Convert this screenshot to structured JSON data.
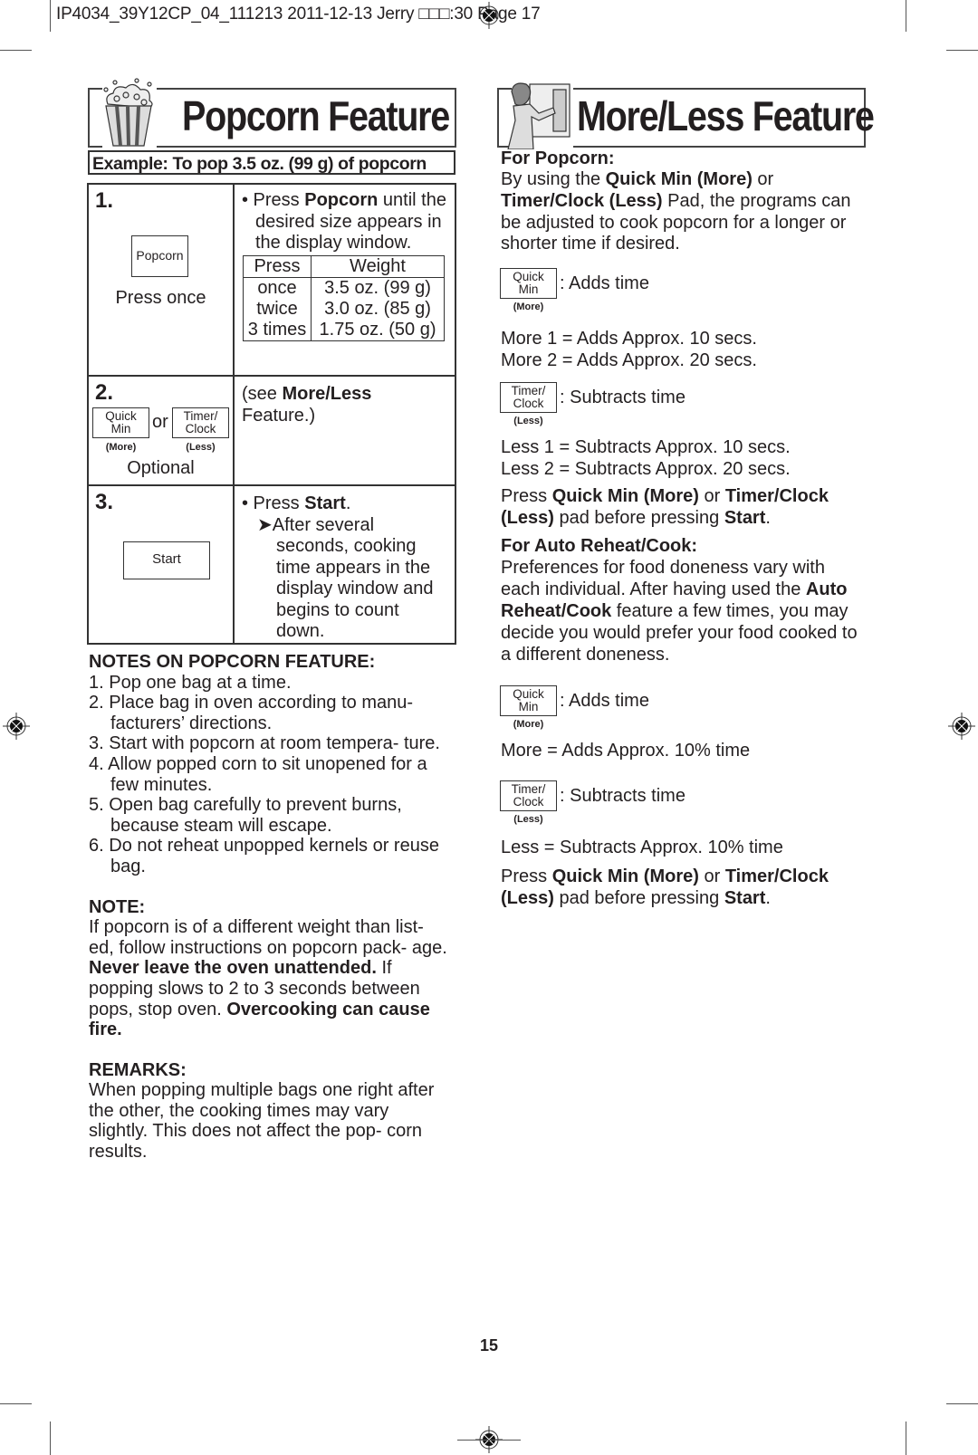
{
  "slug": "IP4034_39Y12CP_04_111213  2011-12-13  Jerry □□□:30  Page 17",
  "popcorn": {
    "title": "Popcorn Feature",
    "example": "Example: To pop 3.5 oz. (99 g) of popcorn",
    "steps": [
      {
        "number": "1.",
        "pad_label": "Popcorn",
        "caption": "Press once",
        "text_pre": "• Press ",
        "text_bold": "Popcorn",
        "text_post": " until the desired size appears in the display window.",
        "weights": {
          "headers": [
            "Press",
            "Weight"
          ],
          "rows": [
            [
              "once",
              "3.5 oz. (99 g)"
            ],
            [
              "twice",
              "3.0 oz. (85 g)"
            ],
            [
              "3 times",
              "1.75 oz. (50 g)"
            ]
          ]
        }
      },
      {
        "number": "2.",
        "pad_more_line1": "Quick",
        "pad_more_line2": "Min",
        "pad_more_sub": "(More)",
        "or": "or",
        "pad_less_line1": "Timer/",
        "pad_less_line2": "Clock",
        "pad_less_sub": "(Less)",
        "caption": "Optional",
        "text_pre": "(see ",
        "text_bold": "More/Less",
        "text_post": " Feature.)"
      },
      {
        "number": "3.",
        "pad_label": "Start",
        "text_pre": "• Press ",
        "text_bold": "Start",
        "text_post": ".",
        "arrow": "➤",
        "subtext": "After several seconds, cooking time appears in the display window and begins to count down."
      }
    ],
    "notes_title": "NOTES ON POPCORN FEATURE:",
    "notes": [
      {
        "n": "1.",
        "text": "Pop one bag at a time."
      },
      {
        "n": "2.",
        "text": "Place bag in oven according to manu- facturers’ directions."
      },
      {
        "n": "3.",
        "text": "Start with popcorn at room tempera- ture."
      },
      {
        "n": "4.",
        "text": "Allow popped corn to sit unopened for a few minutes."
      },
      {
        "n": "5.",
        "text": "Open bag carefully to prevent burns, because steam will escape."
      },
      {
        "n": "6.",
        "text": "Do not reheat unpopped kernels or reuse bag."
      }
    ],
    "note_title": "NOTE:",
    "note_p1": "If popcorn is of a different weight than list- ed, follow instructions on popcorn pack- age. ",
    "note_b1": "Never leave the oven unattended.",
    "note_p2": " If popping slows to 2 to 3 seconds between pops, stop oven. ",
    "note_b2": "Overcooking can cause fire.",
    "remarks_title": "REMARKS:",
    "remarks": "When popping multiple bags one right after the other, the cooking times may vary slightly. This does not affect the pop- corn results."
  },
  "moreless": {
    "title": "More/Less Feature",
    "popcorn_heading": "For Popcorn:",
    "popcorn_intro": {
      "t1": "By using the ",
      "b1": "Quick Min (More)",
      "t2": " or ",
      "b2": "Timer/Clock (Less)",
      "t3": " Pad, the programs can be adjusted to cook popcorn for a longer or shorter time if desired."
    },
    "pad_more": {
      "line1": "Quick",
      "line2": "Min",
      "sub": "(More)",
      "label": ": Adds time"
    },
    "pad_less": {
      "line1": "Timer/",
      "line2": "Clock",
      "sub": "(Less)",
      "label": ": Subtracts time"
    },
    "more_lines": [
      "More 1 = Adds Approx. 10 secs.",
      "More 2 = Adds Approx. 20 secs."
    ],
    "less_lines": [
      "Less 1 = Subtracts Approx. 10 secs.",
      "Less 2 = Subtracts Approx. 20 secs."
    ],
    "press_note": {
      "t1": "Press ",
      "b1": "Quick Min (More)",
      "t2": " or ",
      "b2": "Timer/Clock (Less)",
      "t3": " pad before pressing ",
      "b3": "Start",
      "t4": "."
    },
    "reheat_heading": "For Auto Reheat/Cook:",
    "reheat_intro": {
      "t1": "Preferences for food doneness vary with each individual. After having used the ",
      "b1": "Auto Reheat/Cook",
      "t2": " feature a few times, you may decide you would prefer your food cooked to a different doneness."
    },
    "reheat_more": "More = Adds Approx. 10% time",
    "reheat_less": "Less = Subtracts Approx. 10% time"
  },
  "page_number": "15"
}
